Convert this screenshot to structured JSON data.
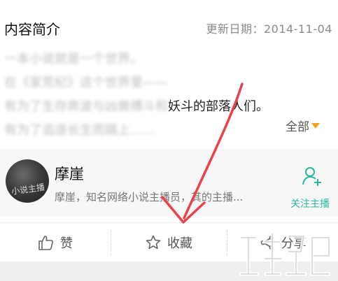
{
  "header": {
    "title": "内容简介",
    "date": "更新日期：2014-11-04"
  },
  "synopsis": {
    "lines": [
      {
        "blurred": "一本小说就是一个世界。",
        "clear": ""
      },
      {
        "blurred": "在《家荒纪》这个世界里——",
        "clear": ""
      },
      {
        "blurred": "有为了生存奔波与凶兽搏斗和",
        "clear": "妖斗的部落人们。"
      },
      {
        "blurred": "有为了追逐长生而踏上……",
        "clear": ""
      }
    ],
    "expand_label": "全部"
  },
  "host": {
    "name": "摩崖",
    "description": "摩崖，知名网络小说主播员，其的主播...",
    "follow_label": "关注主播",
    "avatar_caption": "小说主播"
  },
  "actions": {
    "like": "赞",
    "favorite": "收藏",
    "share": "分享"
  },
  "colors": {
    "accent_teal": "#2bb7a0",
    "expand_triangle": "#f2a21b",
    "arrow": "#e8434b"
  },
  "icons": {
    "like": "thumbs-up-icon",
    "favorite": "star-icon",
    "share": "share-icon",
    "follow": "person-plus-icon"
  }
}
